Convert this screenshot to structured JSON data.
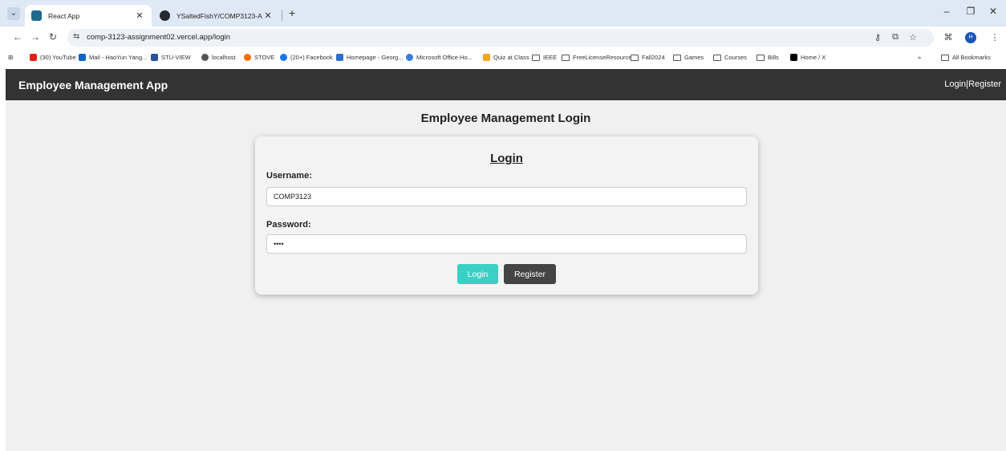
{
  "browser": {
    "tabs": [
      {
        "title": "React App",
        "active": true
      },
      {
        "title": "YSaltedFishY/COMP3123-Assig",
        "active": false
      }
    ],
    "url": "comp-3123-assignment02.vercel.app/login",
    "bookmarks": [
      {
        "label": "(30) YouTube",
        "color": "#e62117"
      },
      {
        "label": "Mail - HaoYun Yang...",
        "color": "#0a66c2"
      },
      {
        "label": "STU-VIEW",
        "color": "#2a4f9c"
      },
      {
        "label": "localhost",
        "color": "#555555"
      },
      {
        "label": "STOVE",
        "color": "#ff6a00"
      },
      {
        "label": "(20+) Facebook",
        "color": "#1877f2"
      },
      {
        "label": "Homepage - Georg...",
        "color": "#2a6fc9"
      },
      {
        "label": "Microsoft Office Ho...",
        "color": "#3b7ddd"
      },
      {
        "label": "Quiz at Class",
        "color": "#f5a623"
      },
      {
        "label": "IEEE",
        "folder": true
      },
      {
        "label": "FreeLicenseResource",
        "folder": true
      },
      {
        "label": "Fall2024",
        "folder": true
      },
      {
        "label": "Games",
        "folder": true
      },
      {
        "label": "Courses",
        "folder": true
      },
      {
        "label": "Bills",
        "folder": true
      },
      {
        "label": "Home / X",
        "color": "#000000"
      }
    ],
    "all_bookmarks": "All Bookmarks",
    "profile_initial": "H"
  },
  "app": {
    "brand": "Employee Management App",
    "nav_login": "Login",
    "nav_sep": "|",
    "nav_register": "Register",
    "page_title": "Employee Management Login",
    "form": {
      "title": "Login",
      "username_label": "Username:",
      "username_value": "COMP3123",
      "password_label": "Password:",
      "password_value": "••••",
      "login_button": "Login",
      "register_button": "Register"
    },
    "colors": {
      "navbar": "#333333",
      "login_button": "#3ad1c4",
      "register_button": "#444444"
    }
  }
}
